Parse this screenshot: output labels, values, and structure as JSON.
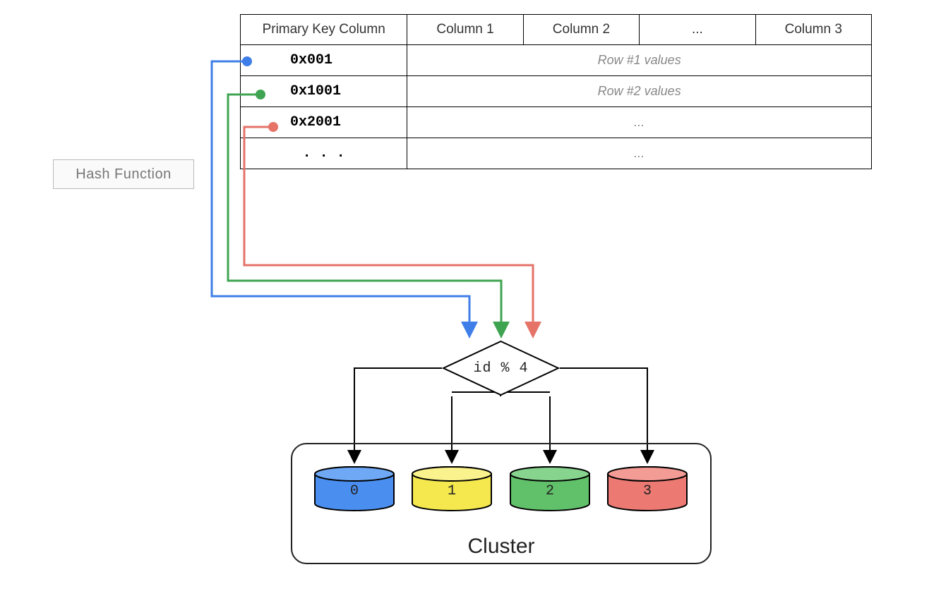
{
  "hash_label": "Hash Function",
  "table": {
    "headers": [
      "Primary Key Column",
      "Column 1",
      "Column 2",
      "...",
      "Column 3"
    ],
    "rows": [
      {
        "key": "0x001",
        "value": "Row #1 values"
      },
      {
        "key": "0x1001",
        "value": "Row #2 values"
      },
      {
        "key": "0x2001",
        "value": "..."
      },
      {
        "key": ". . .",
        "value": "..."
      }
    ]
  },
  "decision_label": "id % 4",
  "cluster": {
    "title": "Cluster",
    "nodes": [
      {
        "id": "0",
        "fill": "#4a8ff0",
        "stroke": "#1b5db5"
      },
      {
        "id": "1",
        "fill": "#f4e84e",
        "stroke": "#c2b800"
      },
      {
        "id": "2",
        "fill": "#61c06a",
        "stroke": "#2f8a3a"
      },
      {
        "id": "3",
        "fill": "#ec7a73",
        "stroke": "#c23c36"
      }
    ]
  },
  "wires": {
    "blue": "#3f7ee8",
    "green": "#3fa451",
    "red": "#e57368"
  }
}
